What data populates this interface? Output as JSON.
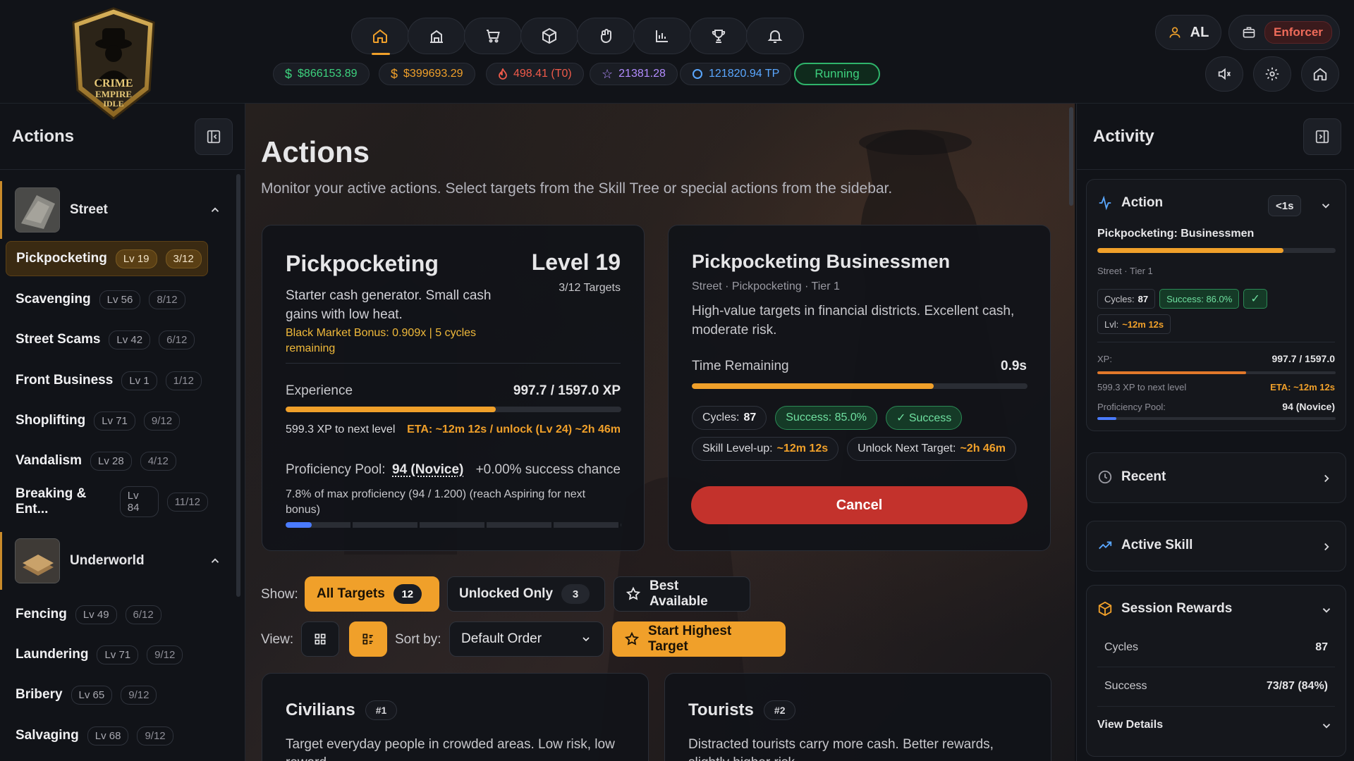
{
  "app": {
    "logo_text": "CRIME EMPIRE IDLE"
  },
  "topnav": {
    "icons": [
      "home-icon",
      "building-icon",
      "cart-icon",
      "box-icon",
      "fist-icon",
      "chart-icon",
      "trophy-icon",
      "bell-icon"
    ],
    "active_index": 0,
    "stats": {
      "cash": "$866153.89",
      "dirty": "$399693.29",
      "heat": "498.41 (T0)",
      "stars": "21381.28",
      "tp": "121820.94 TP",
      "running": "Running"
    },
    "user_initials": "AL",
    "role": "Enforcer"
  },
  "sidebar": {
    "title": "Actions",
    "categories": [
      {
        "name": "Street",
        "items": [
          {
            "name": "Pickpocketing",
            "level": "Lv 19",
            "targets": "3/12"
          },
          {
            "name": "Scavenging",
            "level": "Lv 56",
            "targets": "8/12"
          },
          {
            "name": "Street Scams",
            "level": "Lv 42",
            "targets": "6/12"
          },
          {
            "name": "Front Business",
            "level": "Lv 1",
            "targets": "1/12"
          },
          {
            "name": "Shoplifting",
            "level": "Lv 71",
            "targets": "9/12"
          },
          {
            "name": "Vandalism",
            "level": "Lv 28",
            "targets": "4/12"
          },
          {
            "name": "Breaking & Ent...",
            "level": "Lv 84",
            "targets": "11/12"
          }
        ]
      },
      {
        "name": "Underworld",
        "items": [
          {
            "name": "Fencing",
            "level": "Lv 49",
            "targets": "6/12"
          },
          {
            "name": "Laundering",
            "level": "Lv 71",
            "targets": "9/12"
          },
          {
            "name": "Bribery",
            "level": "Lv 65",
            "targets": "9/12"
          },
          {
            "name": "Salvaging",
            "level": "Lv 68",
            "targets": "9/12"
          }
        ]
      }
    ]
  },
  "main": {
    "title": "Actions",
    "subtitle": "Monitor your active actions. Select targets from the Skill Tree or special actions from the sidebar.",
    "skill": {
      "name": "Pickpocketing",
      "level": "Level 19",
      "targets": "3/12 Targets",
      "desc": "Starter cash generator. Small cash gains with low heat.",
      "bonus": "Black Market Bonus: 0.909x | 5 cycles remaining",
      "exp_label": "Experience",
      "exp_value": "997.7 / 1597.0 XP",
      "exp_progress": 0.625,
      "to_next": "599.3 XP to next level",
      "eta": "ETA: ~12m 12s / unlock (Lv 24) ~2h 46m",
      "prof_label": "Proficiency Pool:",
      "prof_value": "94 (Novice)",
      "prof_bonus": "+0.00% success chance",
      "prof_note": "7.8% of max proficiency (94 / 1.200) (reach Aspiring for next bonus)",
      "prof_progress": 0.078
    },
    "target": {
      "name": "Pickpocketing Businessmen",
      "path": "Street · Pickpocketing · Tier 1",
      "desc": "High-value targets in financial districts. Excellent cash, moderate risk.",
      "time_label": "Time Remaining",
      "time_value": "0.9s",
      "time_progress": 0.72,
      "cycles_label": "Cycles:",
      "cycles_value": "87",
      "success_rate": "Success: 85.0%",
      "success_status": "✓ Success",
      "levelup_label": "Skill Level-up:",
      "levelup_value": "~12m 12s",
      "unlock_label": "Unlock Next Target:",
      "unlock_value": "~2h 46m",
      "cancel": "Cancel"
    },
    "filters": {
      "show_label": "Show:",
      "all": "All Targets",
      "all_count": "12",
      "unlocked": "Unlocked Only",
      "unlocked_count": "3",
      "best": "Best Available",
      "view_label": "View:",
      "sort_label": "Sort by:",
      "sort_value": "Default Order",
      "start": "Start Highest Target"
    },
    "target_cards": [
      {
        "name": "Civilians",
        "rank": "#1",
        "desc": "Target everyday people in crowded areas. Low risk, low reward."
      },
      {
        "name": "Tourists",
        "rank": "#2",
        "desc": "Distracted tourists carry more cash. Better rewards, slightly higher risk."
      }
    ]
  },
  "activity": {
    "title": "Activity",
    "action": {
      "label": "Action",
      "timer": "<1s",
      "name": "Pickpocketing: Businessmen",
      "progress": 0.78,
      "path": "Street · Tier 1",
      "cycles_label": "Cycles:",
      "cycles": "87",
      "success": "Success: 86.0%",
      "check": "✓",
      "lvl_label": "Lvl:",
      "lvl_eta": "~12m 12s",
      "xp_label": "XP:",
      "xp_value": "997.7 / 1597.0",
      "xp_progress": 0.625,
      "to_next": "599.3 XP to next level",
      "eta": "ETA: ~12m 12s",
      "prof_label": "Proficiency Pool:",
      "prof_value": "94 (Novice)",
      "prof_progress": 0.08
    },
    "recent": "Recent",
    "active_skill": "Active Skill",
    "session": {
      "title": "Session Rewards",
      "rows": [
        {
          "label": "Cycles",
          "value": "87"
        },
        {
          "label": "Success",
          "value": "73/87 (84%)"
        }
      ],
      "details": "View Details"
    }
  }
}
